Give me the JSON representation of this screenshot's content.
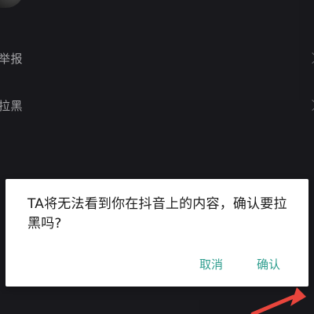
{
  "menu": {
    "items": [
      {
        "label": "举报"
      },
      {
        "label": "拉黑"
      }
    ]
  },
  "dialog": {
    "message": "TA将无法看到你在抖音上的内容，确认要拉黑吗?",
    "cancel_label": "取消",
    "confirm_label": "确认"
  },
  "colors": {
    "background": "#1e1e23",
    "dialog_bg": "#ffffff",
    "accent": "#2f9e8f",
    "annotation_arrow": "#e8453c"
  }
}
